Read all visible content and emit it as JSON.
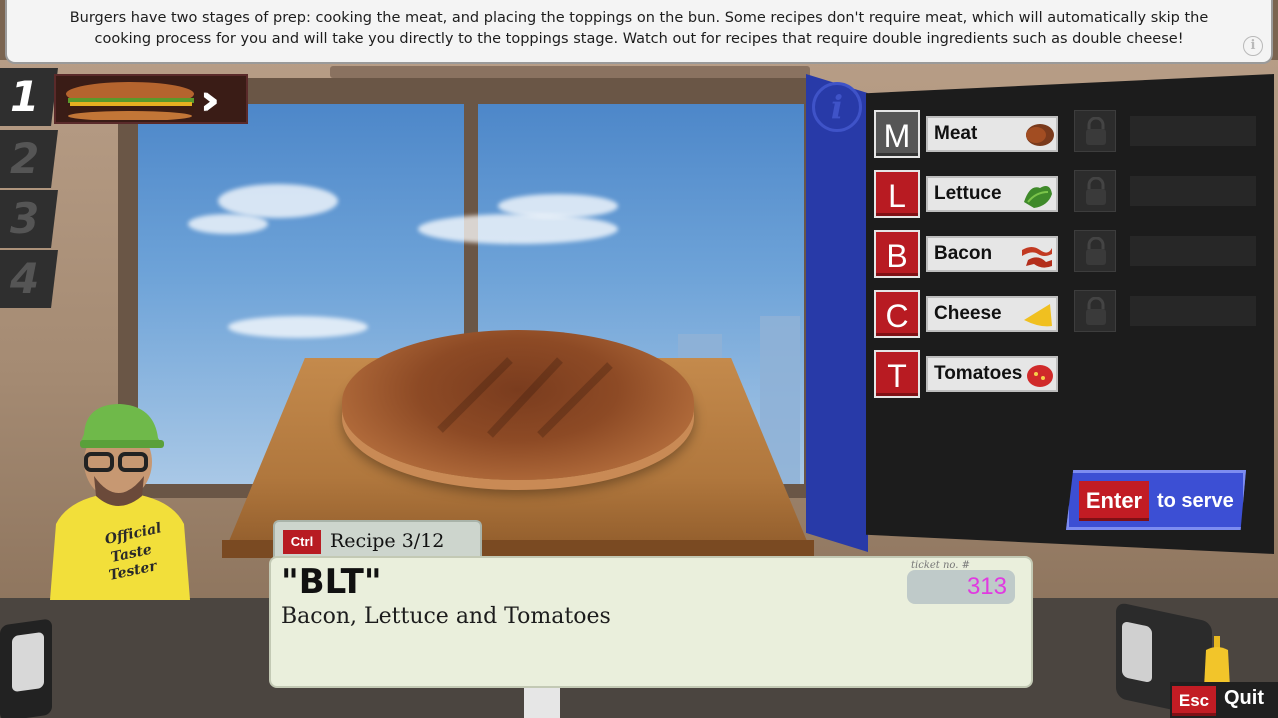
{
  "banner": {
    "text": "Burgers have two stages of prep: cooking the meat, and placing the toppings on the bun. Some recipes don't require meat, which will automatically skip the cooking process for you and will take you directly to the toppings stage. Watch out for recipes that require double ingredients such as double cheese!",
    "info_icon": "i"
  },
  "queue": {
    "slots": [
      "1",
      "2",
      "3",
      "4"
    ],
    "active_slot": "1"
  },
  "ingredients": [
    {
      "key": "M",
      "label": "Meat",
      "key_color": "#565656",
      "icon": "meat-icon"
    },
    {
      "key": "L",
      "label": "Lettuce",
      "key_color": "#b81b22",
      "icon": "lettuce-icon"
    },
    {
      "key": "B",
      "label": "Bacon",
      "key_color": "#b81b22",
      "icon": "bacon-icon"
    },
    {
      "key": "C",
      "label": "Cheese",
      "key_color": "#b81b22",
      "icon": "cheese-icon"
    },
    {
      "key": "T",
      "label": "Tomatoes",
      "key_color": "#b81b22",
      "icon": "tomato-icon"
    }
  ],
  "panel_info_icon": "i",
  "serve": {
    "key": "Enter",
    "label": "to serve"
  },
  "ticket": {
    "ctrl_key": "Ctrl",
    "recipe_count": "Recipe 3/12",
    "name": "\"BLT\"",
    "description": "Bacon, Lettuce and Tomatoes",
    "ticket_no_label": "ticket no. #",
    "ticket_no": "313"
  },
  "tester": {
    "shirt_text": [
      "Official",
      "Taste",
      "Tester"
    ]
  },
  "quit": {
    "key": "Esc",
    "label": "Quit"
  },
  "colors": {
    "key_red": "#b81b22",
    "panel_bg": "#1c1c1c",
    "serve_blue": "#3c4fd4",
    "ticket_no": "#e03ae0"
  }
}
